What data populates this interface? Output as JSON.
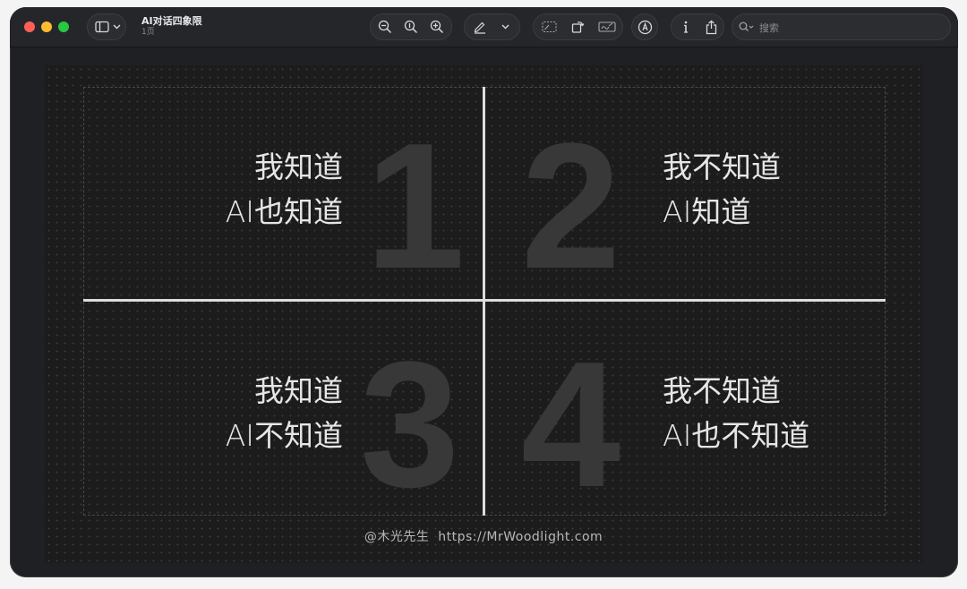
{
  "window": {
    "title": "AI对话四象限",
    "subtitle": "1页"
  },
  "toolbar": {
    "icons": [
      "sidebar-icon",
      "chevron-down-icon",
      "zoom-out-icon",
      "actual-size-icon",
      "zoom-in-icon",
      "pen-icon",
      "chevron-down-icon",
      "rectangle-select-icon",
      "rotate-icon",
      "signature-icon",
      "markup-icon",
      "info-icon",
      "share-icon",
      "search-icon"
    ]
  },
  "search": {
    "placeholder": "搜索"
  },
  "quadrants": [
    {
      "number": "1",
      "line1": "我知道",
      "line2": "AI也知道"
    },
    {
      "number": "2",
      "line1": "我不知道",
      "line2": "AI知道"
    },
    {
      "number": "3",
      "line1": "我知道",
      "line2": "AI不知道"
    },
    {
      "number": "4",
      "line1": "我不知道",
      "line2": "AI也不知道"
    }
  ],
  "footer": {
    "credit": "@木光先生  https://MrWoodlight.com"
  },
  "colors": {
    "close": "#ff5f57",
    "minimize": "#febc2e",
    "zoom": "#28c840",
    "axis": "#dcdcdc",
    "big_number": "#383838"
  }
}
